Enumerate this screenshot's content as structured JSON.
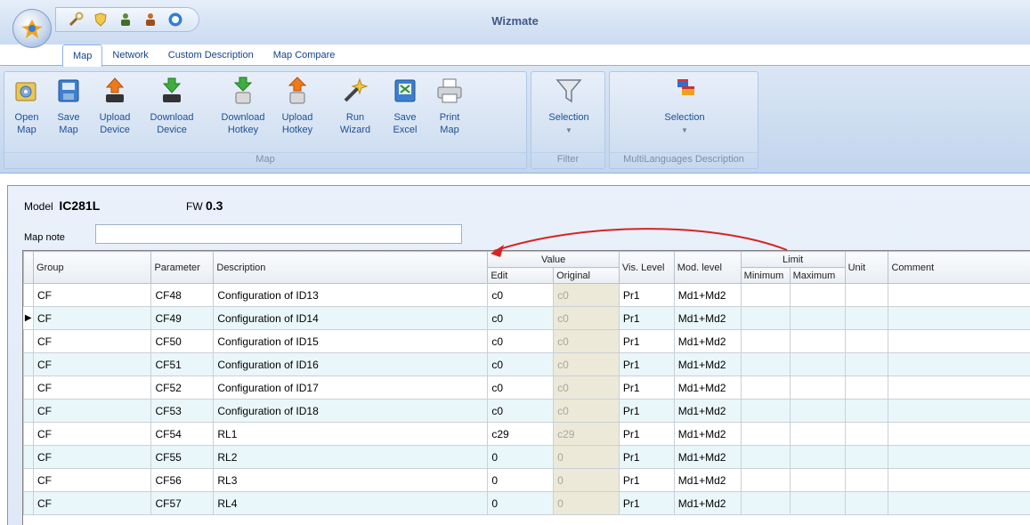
{
  "window": {
    "title": "Wizmate"
  },
  "tabs": [
    "Map",
    "Network",
    "Custom Description",
    "Map Compare"
  ],
  "ribbon": {
    "buttons": [
      {
        "label": "Open\nMap",
        "icon": "open-map-icon"
      },
      {
        "label": "Save\nMap",
        "icon": "save-map-icon"
      },
      {
        "label": "Upload\nDevice",
        "icon": "upload-device-icon"
      },
      {
        "label": "Download\nDevice",
        "icon": "download-device-icon"
      },
      {
        "label": "Download\nHotkey",
        "icon": "download-hotkey-icon"
      },
      {
        "label": "Upload\nHotkey",
        "icon": "upload-hotkey-icon"
      },
      {
        "label": "Run\nWizard",
        "icon": "wizard-wand-icon"
      },
      {
        "label": "Save\nExcel",
        "icon": "save-excel-icon"
      },
      {
        "label": "Print\nMap",
        "icon": "printer-icon"
      },
      {
        "label": "Selection",
        "icon": "funnel-icon"
      },
      {
        "label": "Selection",
        "icon": "languages-flag-icon"
      }
    ],
    "groups": [
      "Map",
      "Filter",
      "MultiLanguages Description"
    ]
  },
  "header": {
    "model_label": "Model",
    "model_value": "IC281L",
    "fw_label": "FW",
    "fw_value": "0.3",
    "mapnote_label": "Map note",
    "mapnote_value": ""
  },
  "table": {
    "headers": {
      "group": "Group",
      "parameter": "Parameter",
      "description": "Description",
      "value": "Value",
      "edit": "Edit",
      "original": "Original",
      "vis_level": "Vis. Level",
      "mod_level": "Mod. level",
      "limit": "Limit",
      "minimum": "Minimum",
      "maximum": "Maximum",
      "unit": "Unit",
      "comment": "Comment"
    },
    "selected_row_marker": "▶",
    "rows": [
      {
        "group": "CF",
        "parameter": "CF48",
        "description": "Configuration of ID13",
        "edit": "c0",
        "original": "c0",
        "vis": "Pr1",
        "mod": "Md1+Md2"
      },
      {
        "group": "CF",
        "parameter": "CF49",
        "description": "Configuration of ID14",
        "edit": "c0",
        "original": "c0",
        "vis": "Pr1",
        "mod": "Md1+Md2"
      },
      {
        "group": "CF",
        "parameter": "CF50",
        "description": "Configuration of ID15",
        "edit": "c0",
        "original": "c0",
        "vis": "Pr1",
        "mod": "Md1+Md2"
      },
      {
        "group": "CF",
        "parameter": "CF51",
        "description": "Configuration of ID16",
        "edit": "c0",
        "original": "c0",
        "vis": "Pr1",
        "mod": "Md1+Md2"
      },
      {
        "group": "CF",
        "parameter": "CF52",
        "description": "Configuration of ID17",
        "edit": "c0",
        "original": "c0",
        "vis": "Pr1",
        "mod": "Md1+Md2"
      },
      {
        "group": "CF",
        "parameter": "CF53",
        "description": "Configuration of ID18",
        "edit": "c0",
        "original": "c0",
        "vis": "Pr1",
        "mod": "Md1+Md2"
      },
      {
        "group": "CF",
        "parameter": "CF54",
        "description": "RL1",
        "edit": "c29",
        "original": "c29",
        "vis": "Pr1",
        "mod": "Md1+Md2"
      },
      {
        "group": "CF",
        "parameter": "CF55",
        "description": "RL2",
        "edit": "0",
        "original": "0",
        "vis": "Pr1",
        "mod": "Md1+Md2"
      },
      {
        "group": "CF",
        "parameter": "CF56",
        "description": "RL3",
        "edit": "0",
        "original": "0",
        "vis": "Pr1",
        "mod": "Md1+Md2"
      },
      {
        "group": "CF",
        "parameter": "CF57",
        "description": "RL4",
        "edit": "0",
        "original": "0",
        "vis": "Pr1",
        "mod": "Md1+Md2"
      }
    ]
  },
  "colors": {
    "annotation_arrow": "#d62424",
    "original_cell": "#ece9d8",
    "alt_row": "#eaf7fa"
  }
}
